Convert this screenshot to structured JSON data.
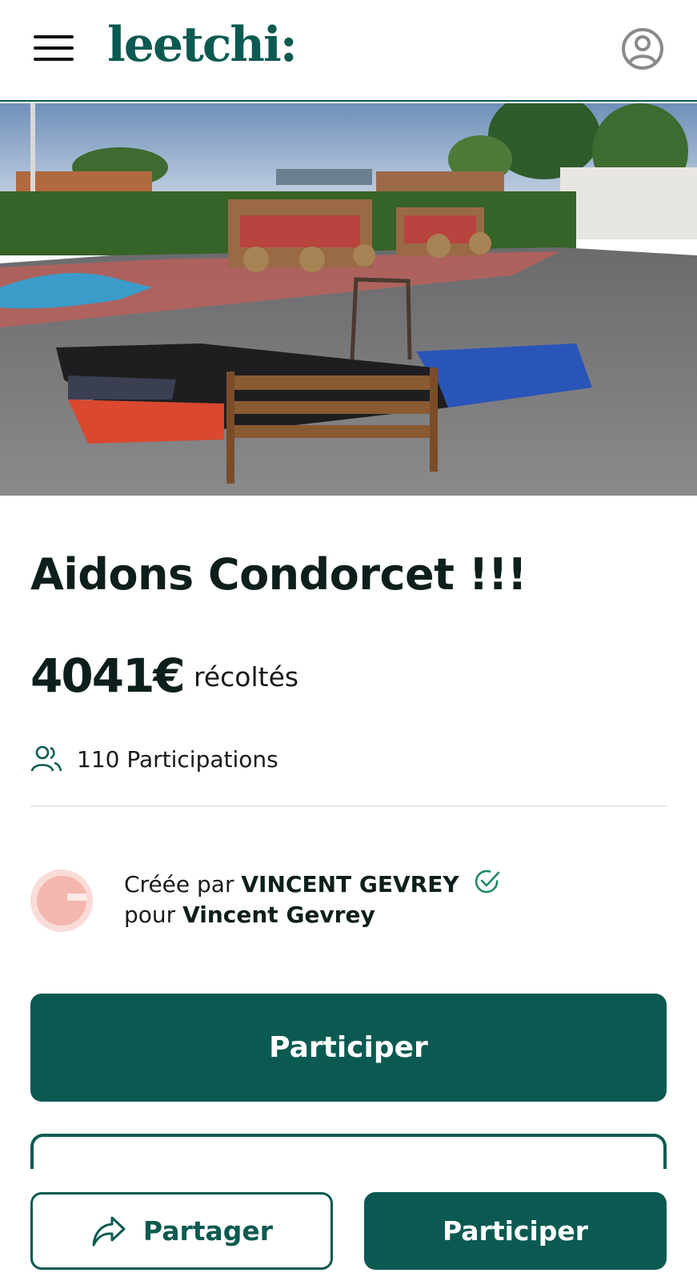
{
  "header": {
    "logo_text": "leetchi:",
    "menu_icon": "hamburger-menu-icon",
    "account_icon": "user-circle-icon"
  },
  "hero": {
    "image_description": "Burnt mattresses and furniture in a school playground"
  },
  "campaign": {
    "title": "Aidons Condorcet !!!",
    "amount": "4041€",
    "amount_label": "récoltés",
    "participations": "110 Participations",
    "creator_prefix": "Créée par",
    "creator_name": "VINCENT GEVREY",
    "beneficiary_prefix": "pour",
    "beneficiary_name": "Vincent Gevrey"
  },
  "actions": {
    "participate_label": "Participer",
    "share_label": "Partager",
    "participate_bottom_label": "Participer"
  },
  "colors": {
    "brand": "#0b5a51",
    "text": "#0d1f1c",
    "avatar_bg": "#f9dcd8",
    "verified": "#1f8a5f"
  }
}
